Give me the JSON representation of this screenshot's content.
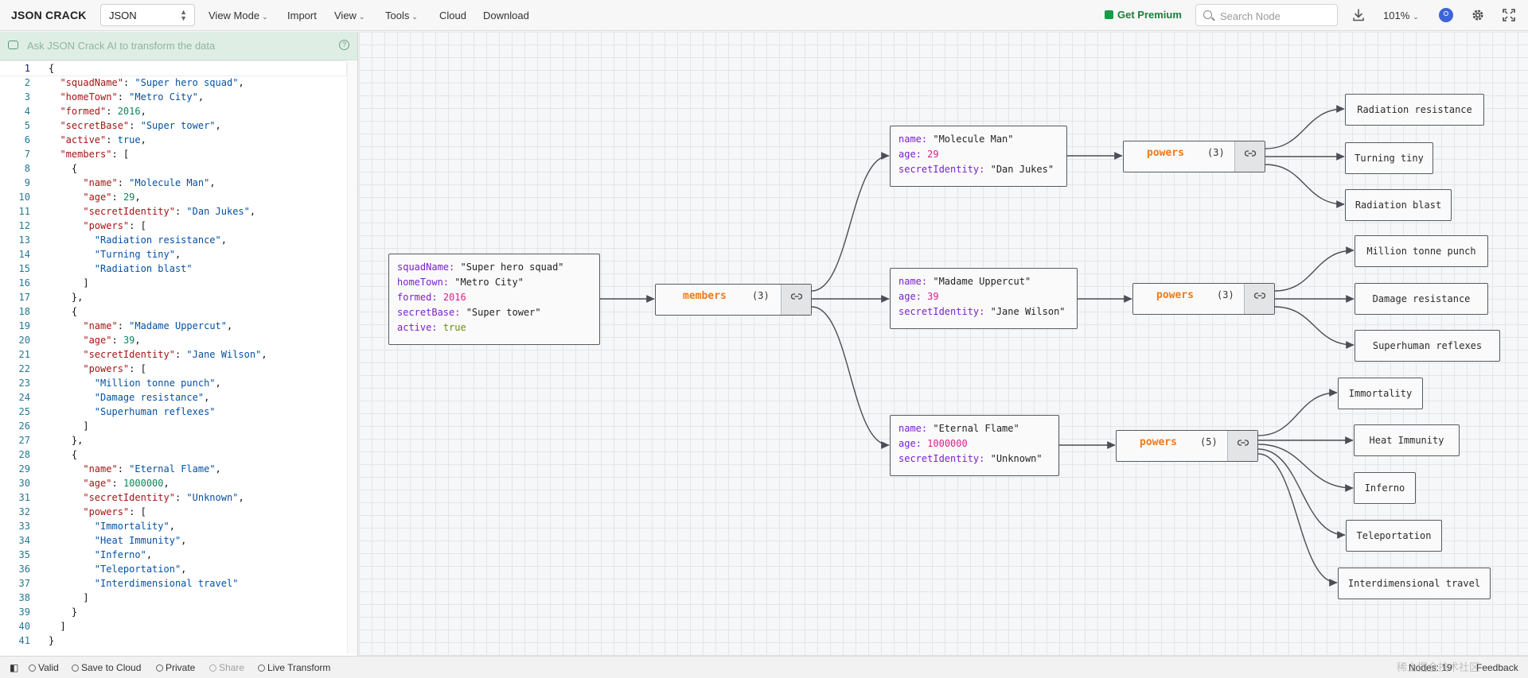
{
  "app": {
    "logo": "JSON CRACK"
  },
  "toolbar": {
    "format_value": "JSON",
    "menus": [
      "View Mode",
      "Import",
      "View",
      "Tools",
      "Cloud",
      "Download"
    ],
    "get_premium": "Get Premium",
    "search_placeholder": "Search Node",
    "zoom": "101%"
  },
  "ai_bar": {
    "text": "Ask JSON Crack AI to transform the data"
  },
  "editor": {
    "lines": [
      [
        [
          "p",
          "{"
        ]
      ],
      [
        [
          "p",
          "  "
        ],
        [
          "k",
          "\"squadName\""
        ],
        [
          "p",
          ": "
        ],
        [
          "s",
          "\"Super hero squad\""
        ],
        [
          "p",
          ","
        ]
      ],
      [
        [
          "p",
          "  "
        ],
        [
          "k",
          "\"homeTown\""
        ],
        [
          "p",
          ": "
        ],
        [
          "s",
          "\"Metro City\""
        ],
        [
          "p",
          ","
        ]
      ],
      [
        [
          "p",
          "  "
        ],
        [
          "k",
          "\"formed\""
        ],
        [
          "p",
          ": "
        ],
        [
          "n",
          "2016"
        ],
        [
          "p",
          ","
        ]
      ],
      [
        [
          "p",
          "  "
        ],
        [
          "k",
          "\"secretBase\""
        ],
        [
          "p",
          ": "
        ],
        [
          "s",
          "\"Super tower\""
        ],
        [
          "p",
          ","
        ]
      ],
      [
        [
          "p",
          "  "
        ],
        [
          "k",
          "\"active\""
        ],
        [
          "p",
          ": "
        ],
        [
          "b",
          "true"
        ],
        [
          "p",
          ","
        ]
      ],
      [
        [
          "p",
          "  "
        ],
        [
          "k",
          "\"members\""
        ],
        [
          "p",
          ": ["
        ]
      ],
      [
        [
          "p",
          "    {"
        ]
      ],
      [
        [
          "p",
          "      "
        ],
        [
          "k",
          "\"name\""
        ],
        [
          "p",
          ": "
        ],
        [
          "s",
          "\"Molecule Man\""
        ],
        [
          "p",
          ","
        ]
      ],
      [
        [
          "p",
          "      "
        ],
        [
          "k",
          "\"age\""
        ],
        [
          "p",
          ": "
        ],
        [
          "n",
          "29"
        ],
        [
          "p",
          ","
        ]
      ],
      [
        [
          "p",
          "      "
        ],
        [
          "k",
          "\"secretIdentity\""
        ],
        [
          "p",
          ": "
        ],
        [
          "s",
          "\"Dan Jukes\""
        ],
        [
          "p",
          ","
        ]
      ],
      [
        [
          "p",
          "      "
        ],
        [
          "k",
          "\"powers\""
        ],
        [
          "p",
          ": ["
        ]
      ],
      [
        [
          "p",
          "        "
        ],
        [
          "s",
          "\"Radiation resistance\""
        ],
        [
          "p",
          ","
        ]
      ],
      [
        [
          "p",
          "        "
        ],
        [
          "s",
          "\"Turning tiny\""
        ],
        [
          "p",
          ","
        ]
      ],
      [
        [
          "p",
          "        "
        ],
        [
          "s",
          "\"Radiation blast\""
        ]
      ],
      [
        [
          "p",
          "      ]"
        ]
      ],
      [
        [
          "p",
          "    },"
        ]
      ],
      [
        [
          "p",
          "    {"
        ]
      ],
      [
        [
          "p",
          "      "
        ],
        [
          "k",
          "\"name\""
        ],
        [
          "p",
          ": "
        ],
        [
          "s",
          "\"Madame Uppercut\""
        ],
        [
          "p",
          ","
        ]
      ],
      [
        [
          "p",
          "      "
        ],
        [
          "k",
          "\"age\""
        ],
        [
          "p",
          ": "
        ],
        [
          "n",
          "39"
        ],
        [
          "p",
          ","
        ]
      ],
      [
        [
          "p",
          "      "
        ],
        [
          "k",
          "\"secretIdentity\""
        ],
        [
          "p",
          ": "
        ],
        [
          "s",
          "\"Jane Wilson\""
        ],
        [
          "p",
          ","
        ]
      ],
      [
        [
          "p",
          "      "
        ],
        [
          "k",
          "\"powers\""
        ],
        [
          "p",
          ": ["
        ]
      ],
      [
        [
          "p",
          "        "
        ],
        [
          "s",
          "\"Million tonne punch\""
        ],
        [
          "p",
          ","
        ]
      ],
      [
        [
          "p",
          "        "
        ],
        [
          "s",
          "\"Damage resistance\""
        ],
        [
          "p",
          ","
        ]
      ],
      [
        [
          "p",
          "        "
        ],
        [
          "s",
          "\"Superhuman reflexes\""
        ]
      ],
      [
        [
          "p",
          "      ]"
        ]
      ],
      [
        [
          "p",
          "    },"
        ]
      ],
      [
        [
          "p",
          "    {"
        ]
      ],
      [
        [
          "p",
          "      "
        ],
        [
          "k",
          "\"name\""
        ],
        [
          "p",
          ": "
        ],
        [
          "s",
          "\"Eternal Flame\""
        ],
        [
          "p",
          ","
        ]
      ],
      [
        [
          "p",
          "      "
        ],
        [
          "k",
          "\"age\""
        ],
        [
          "p",
          ": "
        ],
        [
          "n",
          "1000000"
        ],
        [
          "p",
          ","
        ]
      ],
      [
        [
          "p",
          "      "
        ],
        [
          "k",
          "\"secretIdentity\""
        ],
        [
          "p",
          ": "
        ],
        [
          "s",
          "\"Unknown\""
        ],
        [
          "p",
          ","
        ]
      ],
      [
        [
          "p",
          "      "
        ],
        [
          "k",
          "\"powers\""
        ],
        [
          "p",
          ": ["
        ]
      ],
      [
        [
          "p",
          "        "
        ],
        [
          "s",
          "\"Immortality\""
        ],
        [
          "p",
          ","
        ]
      ],
      [
        [
          "p",
          "        "
        ],
        [
          "s",
          "\"Heat Immunity\""
        ],
        [
          "p",
          ","
        ]
      ],
      [
        [
          "p",
          "        "
        ],
        [
          "s",
          "\"Inferno\""
        ],
        [
          "p",
          ","
        ]
      ],
      [
        [
          "p",
          "        "
        ],
        [
          "s",
          "\"Teleportation\""
        ],
        [
          "p",
          ","
        ]
      ],
      [
        [
          "p",
          "        "
        ],
        [
          "s",
          "\"Interdimensional travel\""
        ]
      ],
      [
        [
          "p",
          "      ]"
        ]
      ],
      [
        [
          "p",
          "    }"
        ]
      ],
      [
        [
          "p",
          "  ]"
        ]
      ],
      [
        [
          "p",
          "}"
        ]
      ]
    ]
  },
  "graph": {
    "root": [
      {
        "key": "squadName",
        "value": "\"Super hero squad\"",
        "kind": "str"
      },
      {
        "key": "homeTown",
        "value": "\"Metro City\"",
        "kind": "str"
      },
      {
        "key": "formed",
        "value": "2016",
        "kind": "num"
      },
      {
        "key": "secretBase",
        "value": "\"Super tower\"",
        "kind": "str"
      },
      {
        "key": "active",
        "value": "true",
        "kind": "bool"
      }
    ],
    "members": {
      "name": "members",
      "count": "(3)"
    },
    "people": [
      {
        "fields": [
          {
            "key": "name",
            "value": "\"Molecule Man\"",
            "kind": "str"
          },
          {
            "key": "age",
            "value": "29",
            "kind": "num"
          },
          {
            "key": "secretIdentity",
            "value": "\"Dan Jukes\"",
            "kind": "str"
          }
        ],
        "powers": {
          "name": "powers",
          "count": "(3)"
        },
        "items": [
          "Radiation resistance",
          "Turning tiny",
          "Radiation blast"
        ]
      },
      {
        "fields": [
          {
            "key": "name",
            "value": "\"Madame Uppercut\"",
            "kind": "str"
          },
          {
            "key": "age",
            "value": "39",
            "kind": "num"
          },
          {
            "key": "secretIdentity",
            "value": "\"Jane Wilson\"",
            "kind": "str"
          }
        ],
        "powers": {
          "name": "powers",
          "count": "(3)"
        },
        "items": [
          "Million tonne punch",
          "Damage resistance",
          "Superhuman reflexes"
        ]
      },
      {
        "fields": [
          {
            "key": "name",
            "value": "\"Eternal Flame\"",
            "kind": "str"
          },
          {
            "key": "age",
            "value": "1000000",
            "kind": "num"
          },
          {
            "key": "secretIdentity",
            "value": "\"Unknown\"",
            "kind": "str"
          }
        ],
        "powers": {
          "name": "powers",
          "count": "(5)"
        },
        "items": [
          "Immortality",
          "Heat Immunity",
          "Inferno",
          "Teleportation",
          "Interdimensional travel"
        ]
      }
    ]
  },
  "statusbar": {
    "valid": "Valid",
    "save_to_cloud": "Save to Cloud",
    "private": "Private",
    "share": "Share",
    "live_transform": "Live Transform",
    "nodes": "Nodes: 19",
    "feedback": "Feedback"
  },
  "watermark": "稀土掘金技术社区",
  "colors": {
    "key_purple": "#7a1fd0",
    "number_pink": "#d6218a",
    "bool_green": "#6a8c14",
    "array_orange": "#ee7a1a",
    "premium_green": "#1a7f37"
  }
}
